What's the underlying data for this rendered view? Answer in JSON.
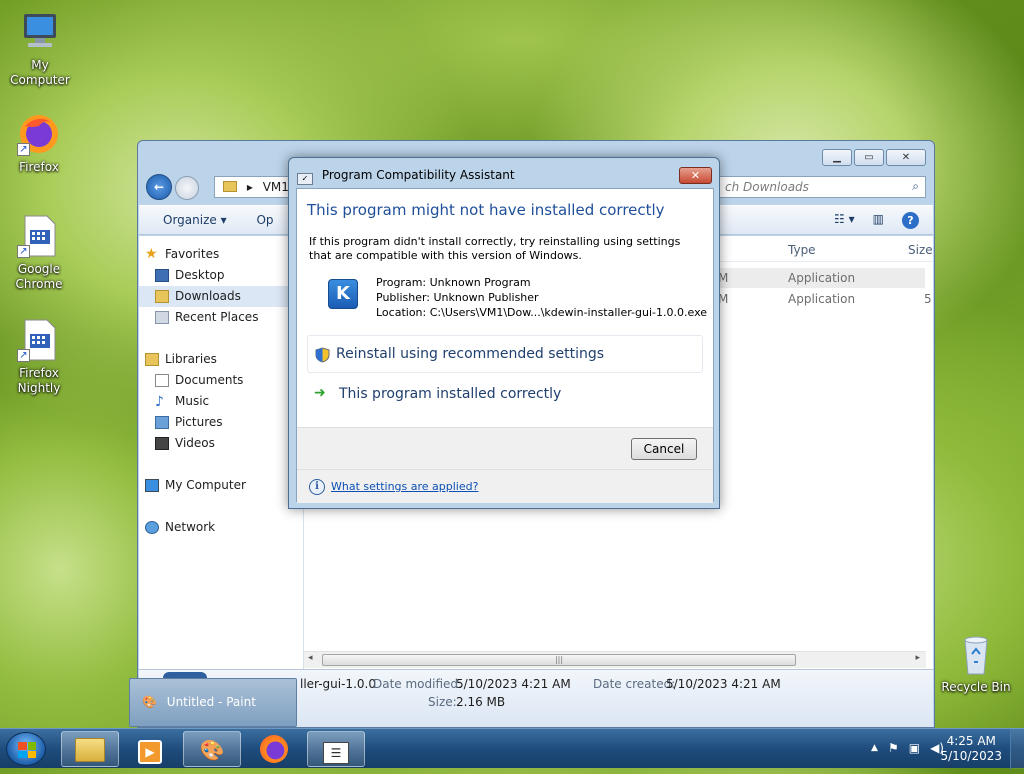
{
  "desktop": {
    "icons": [
      {
        "label": "My Computer",
        "icon": "my-computer-icon"
      },
      {
        "label": "Firefox",
        "icon": "firefox-icon"
      },
      {
        "label": "Google Chrome",
        "icon": "shortcut-file-icon"
      },
      {
        "label": "Firefox Nightly",
        "icon": "shortcut-file-icon"
      },
      {
        "label": "Recycle Bin",
        "icon": "recycle-bin-icon"
      }
    ]
  },
  "explorer": {
    "address_segment": "VM1",
    "search_placeholder": "ch Downloads",
    "toolbar": {
      "organize": "Organize ▾",
      "open": "Op"
    },
    "nav": {
      "favorites": "Favorites",
      "desktop": "Desktop",
      "downloads": "Downloads",
      "recent_places": "Recent Places",
      "libraries": "Libraries",
      "documents": "Documents",
      "music": "Music",
      "pictures": "Pictures",
      "videos": "Videos",
      "my_computer": "My Computer",
      "network": "Network"
    },
    "columns": {
      "type": "Type",
      "size": "Size"
    },
    "rows": [
      {
        "time_fragment": "M",
        "type": "Application",
        "size": ""
      },
      {
        "time_fragment": "M",
        "type": "Application",
        "size": "5"
      }
    ],
    "details": {
      "name": "ller-gui-1.0.0",
      "date_modified_label": "Date modified:",
      "date_modified": "5/10/2023 4:21 AM",
      "date_created_label": "Date created:",
      "date_created": "5/10/2023 4:21 AM",
      "size_label": "Size:",
      "size": "2.16 MB"
    }
  },
  "dialog": {
    "title": "Program Compatibility Assistant",
    "close_glyph": "✕",
    "heading": "This program might not have installed correctly",
    "body_text": "If this program didn't install correctly, try reinstalling using settings that are compatible with this version of Windows.",
    "program": "Program: Unknown Program",
    "publisher": "Publisher: Unknown Publisher",
    "location": "Location: C:\\Users\\VM1\\Dow...\\kdewin-installer-gui-1.0.0.exe",
    "option_reinstall": "Reinstall using recommended settings",
    "option_correct": "This program installed correctly",
    "cancel": "Cancel",
    "help_link": "What settings are applied?"
  },
  "taskbar": {
    "flyout_label": "Untitled - Paint",
    "clock_time": "4:25 AM",
    "clock_date": "5/10/2023",
    "tray_arrow": "▲"
  },
  "colors": {
    "heading_blue": "#1f4f9a",
    "link_blue": "#0c50b4",
    "taskbar": "#1f4d7d"
  }
}
